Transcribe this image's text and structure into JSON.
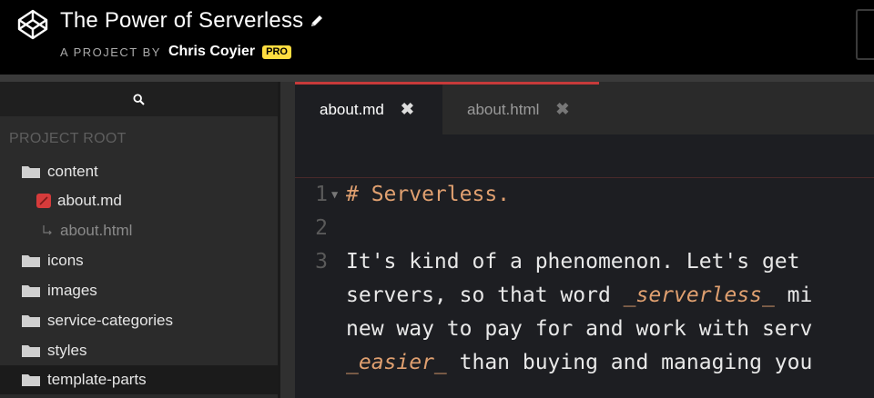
{
  "header": {
    "title": "The Power of Serverless",
    "by_label": "A PROJECT BY",
    "author": "Chris Coyier",
    "badge": "PRO"
  },
  "sidebar": {
    "root_label": "PROJECT ROOT",
    "items": [
      {
        "label": "content",
        "type": "folder"
      },
      {
        "label": "about.md",
        "type": "markdown-file"
      },
      {
        "label": "about.html",
        "type": "generated-file"
      },
      {
        "label": "icons",
        "type": "folder"
      },
      {
        "label": "images",
        "type": "folder"
      },
      {
        "label": "service-categories",
        "type": "folder"
      },
      {
        "label": "styles",
        "type": "folder"
      },
      {
        "label": "template-parts",
        "type": "folder",
        "selected": true
      }
    ]
  },
  "tabs": [
    {
      "label": "about.md",
      "close": "✖",
      "active": true
    },
    {
      "label": "about.html",
      "close": "✖",
      "active": false
    }
  ],
  "editor": {
    "lines": [
      {
        "num": "1",
        "segments": [
          {
            "text": "# Serverless.",
            "style": "heading"
          }
        ]
      },
      {
        "num": "2",
        "segments": []
      },
      {
        "num": "3",
        "segments": [
          {
            "text": "It's kind of a phenomenon. Let's get",
            "style": "text"
          }
        ]
      },
      {
        "num": "",
        "segments": [
          {
            "text": "servers, so that word ",
            "style": "text"
          },
          {
            "text": "_serverless_",
            "style": "em"
          },
          {
            "text": " mi",
            "style": "text"
          }
        ]
      },
      {
        "num": "",
        "segments": [
          {
            "text": "new way to pay for and work with serv",
            "style": "text"
          }
        ]
      },
      {
        "num": "",
        "segments": [
          {
            "text": "_easier_",
            "style": "em"
          },
          {
            "text": " than buying and managing you",
            "style": "text"
          }
        ]
      }
    ]
  },
  "colors": {
    "accent_red": "#c73a3a",
    "pro_yellow": "#ffdd40",
    "markdown_orange": "#e0a070"
  }
}
